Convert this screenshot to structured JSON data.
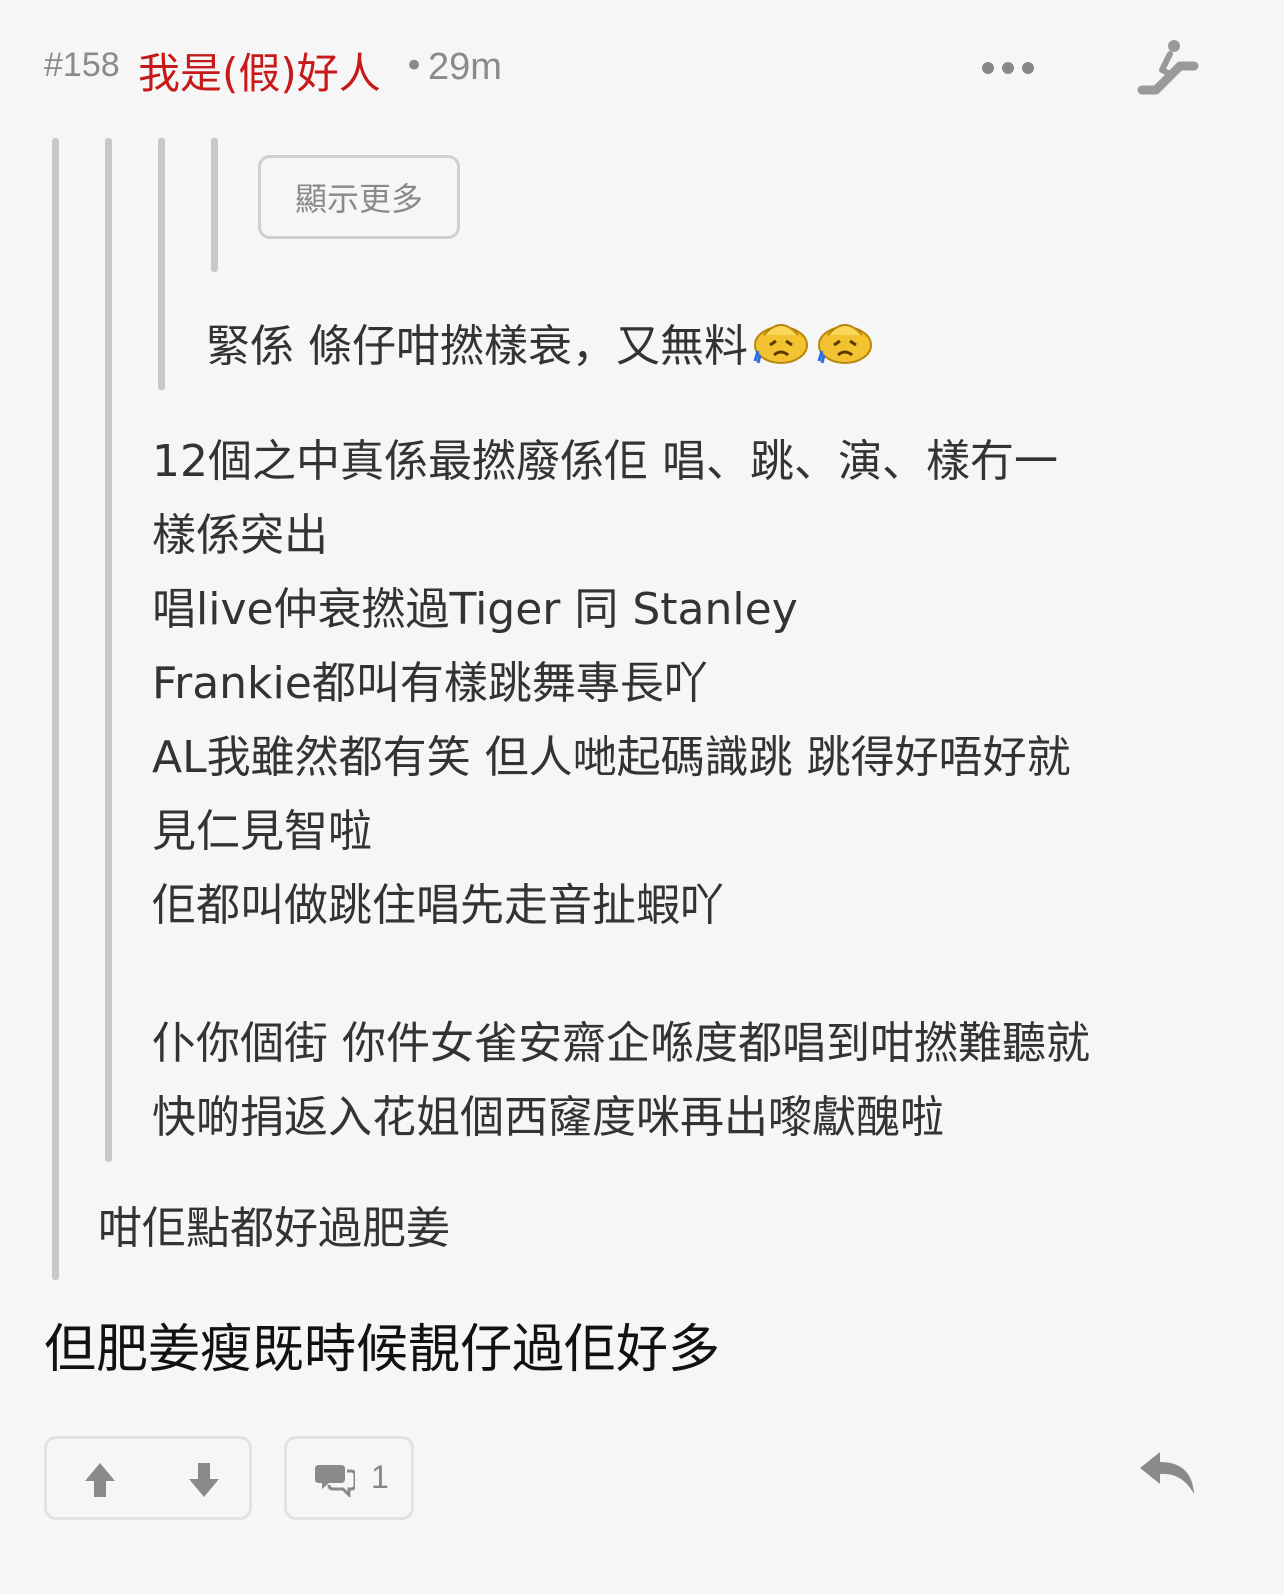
{
  "header": {
    "post_number": "#158",
    "username": "我是(假)好人",
    "separator": "•",
    "time_ago": "29m",
    "more_icon": "more-dots-icon",
    "escalator_icon": "escalator-icon"
  },
  "thread": {
    "show_more_label": "顯示更多",
    "quote_level3": {
      "text": "緊係 條仔咁撚樣衰，又無料",
      "emojis": [
        "crying-face-icon",
        "crying-face-icon"
      ]
    },
    "quote_level2_lines": [
      "12個之中真係最撚廢係佢 唱、跳、演、樣冇一",
      "樣係突出",
      "唱live仲衰撚過Tiger 同 Stanley",
      "Frankie都叫有樣跳舞專長吖",
      "AL我雖然都有笑 但人哋起碼識跳 跳得好唔好就",
      "見仁見智啦",
      "佢都叫做跳住唱先走音扯蝦吖",
      "",
      "仆你個街 你件女雀安齋企喺度都唱到咁撚難聽就",
      "快啲捐返入花姐個西窿度咪再出嚟獻醜啦"
    ],
    "quote_level1": "咁佢點都好過肥姜",
    "reply_text": "但肥姜瘦既時候靚仔過佢好多"
  },
  "footer": {
    "upvote_icon": "upvote-arrow-icon",
    "downvote_icon": "downvote-arrow-icon",
    "comment_icon": "comment-bubble-icon",
    "reply_count": "1",
    "reply_icon": "reply-arrow-icon"
  },
  "colors": {
    "background": "#f6f6f6",
    "username": "#c61a1a",
    "meta_text": "#8a8a8a",
    "quote_bar": "#c8c8c8"
  }
}
